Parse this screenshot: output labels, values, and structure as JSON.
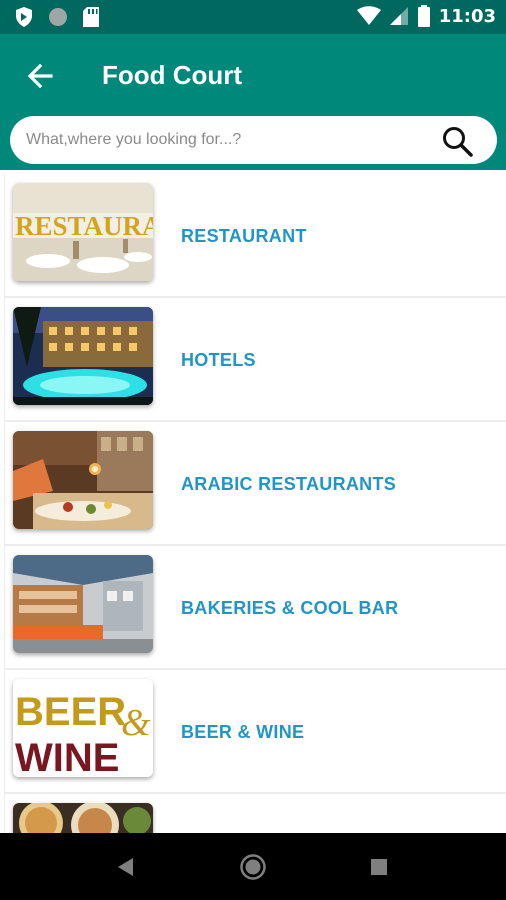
{
  "status_bar": {
    "time": "11:03",
    "icons": [
      "shield-icon",
      "circle-icon",
      "sd-card-icon",
      "wifi-icon",
      "signal-icon",
      "battery-icon"
    ]
  },
  "header": {
    "title": "Food Court",
    "back_icon": "arrow-back-icon"
  },
  "search": {
    "placeholder": "What,where you looking for...?",
    "value": ""
  },
  "categories": [
    {
      "label": "RESTAURANT",
      "image_text": "RESTAURANT"
    },
    {
      "label": "HOTELS"
    },
    {
      "label": "ARABIC RESTAURANTS"
    },
    {
      "label": "BAKERIES & COOL BAR"
    },
    {
      "label": "BEER & WINE",
      "image_text_1": "BEER",
      "image_text_2": "&",
      "image_text_3": "WINE"
    },
    {
      "label": ""
    }
  ],
  "colors": {
    "status_bar": "#00695f",
    "app_bar": "#00897b",
    "label": "#2196c6",
    "nav_bar": "#000000"
  },
  "nav": [
    "back-triangle-icon",
    "home-circle-icon",
    "recents-square-icon"
  ]
}
